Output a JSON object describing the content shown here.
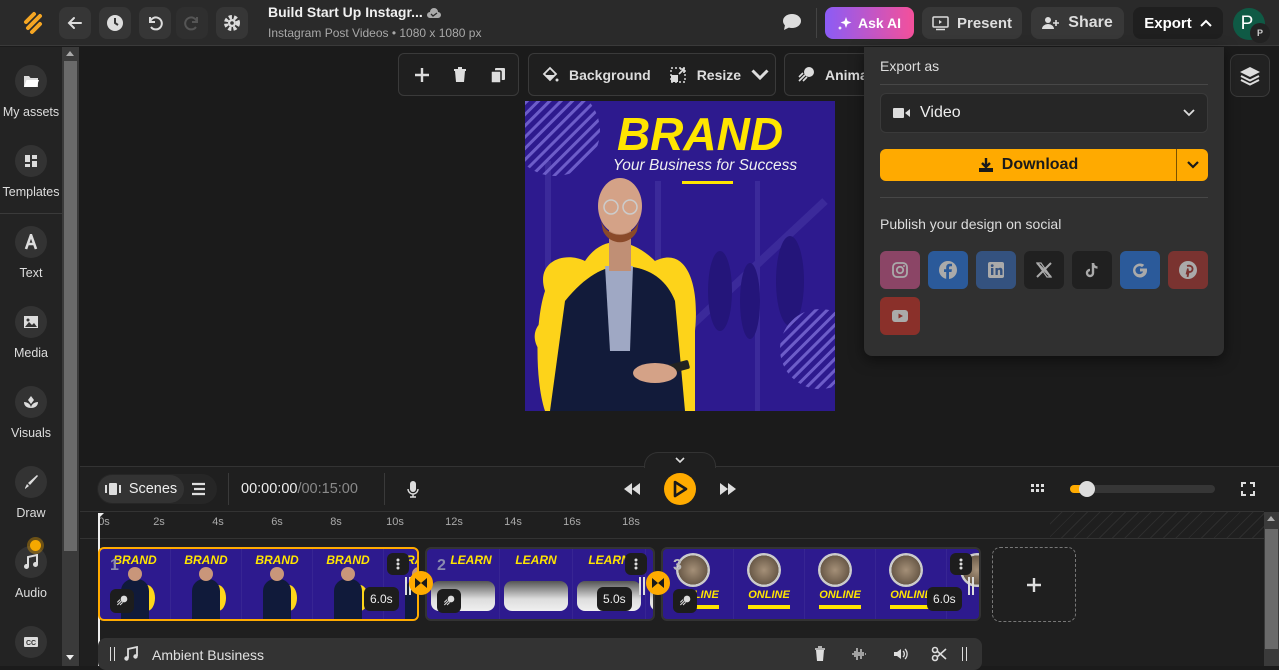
{
  "header": {
    "title": "Build Start Up Instagr...",
    "subtitle": "Instagram Post Videos • 1080 x 1080 px",
    "ask_ai": "Ask AI",
    "present": "Present",
    "share": "Share",
    "export": "Export",
    "avatar_initial": "P",
    "avatar_badge": "P"
  },
  "sidebar": {
    "items": [
      {
        "label": "My assets",
        "icon": "folder-icon"
      },
      {
        "label": "Templates",
        "icon": "templates-icon"
      },
      {
        "label": "Text",
        "icon": "text-icon"
      },
      {
        "label": "Media",
        "icon": "image-icon"
      },
      {
        "label": "Visuals",
        "icon": "visuals-icon"
      },
      {
        "label": "Draw",
        "icon": "brush-icon"
      },
      {
        "label": "Audio",
        "icon": "music-icon"
      },
      {
        "label": "",
        "icon": "captions-icon"
      }
    ]
  },
  "toolbar": {
    "background": "Background",
    "resize": "Resize",
    "animate": "Anima"
  },
  "design": {
    "headline": "BRAND",
    "tagline": "Your Business for Success",
    "brand_color": "#2d1a8e",
    "accent_color": "#ffe500"
  },
  "export_panel": {
    "export_as_label": "Export as",
    "format": "Video",
    "download": "Download",
    "publish_label": "Publish your design on social",
    "socials": [
      {
        "name": "instagram",
        "color": "#8b4566"
      },
      {
        "name": "facebook",
        "color": "#2b5a9a"
      },
      {
        "name": "linkedin",
        "color": "#34527f"
      },
      {
        "name": "x",
        "color": "#202020"
      },
      {
        "name": "tiktok",
        "color": "#202020"
      },
      {
        "name": "google",
        "color": "#2b5a9a"
      },
      {
        "name": "pinterest",
        "color": "#7a3330"
      },
      {
        "name": "youtube",
        "color": "#8a302a"
      }
    ]
  },
  "timeline": {
    "scenes_label": "Scenes",
    "current_time": "00:00:00",
    "total_time": "/00:15:00",
    "zoom_level": 0.1,
    "ticks": [
      "0s",
      "2s",
      "4s",
      "6s",
      "8s",
      "10s",
      "12s",
      "14s",
      "16s",
      "18s"
    ],
    "scenes": [
      {
        "number": "1",
        "title": "BRAND",
        "duration": "6.0s"
      },
      {
        "number": "2",
        "title": "LEARN",
        "duration": "5.0s"
      },
      {
        "number": "3",
        "title": "ONLINE",
        "duration": "6.0s"
      }
    ],
    "audio_track": "Ambient Business"
  }
}
